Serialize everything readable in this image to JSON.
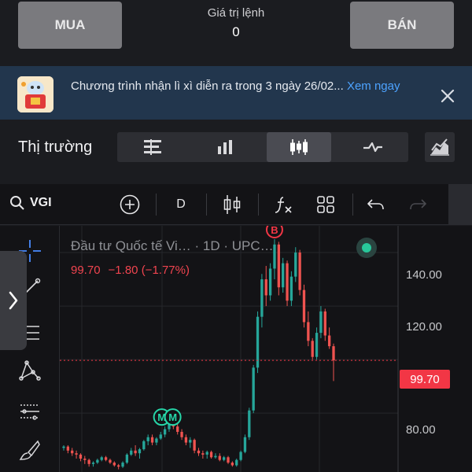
{
  "order": {
    "buy_label": "MUA",
    "sell_label": "BÁN",
    "value_label": "Giá trị lệnh",
    "value": "0"
  },
  "banner": {
    "text": "Chương trình nhận lì xì diễn ra trong 3 ngày 26/02... ",
    "link": "Xem ngay",
    "icon": "lucky-money-mascot-icon",
    "close_icon": "close-icon"
  },
  "market": {
    "title": "Thị trường",
    "views": [
      {
        "name": "order-book-icon",
        "active": false
      },
      {
        "name": "bar-chart-icon",
        "active": false
      },
      {
        "name": "candlestick-icon",
        "active": true
      },
      {
        "name": "line-pulse-icon",
        "active": false
      }
    ],
    "expand_icon": "area-chart-expand-icon"
  },
  "toolbar": {
    "symbol": "VGI",
    "interval": "D",
    "icons": [
      "search-icon",
      "add-symbol-icon",
      "candle-style-icon",
      "indicators-icon",
      "layout-icon",
      "undo-icon",
      "redo-icon"
    ]
  },
  "legend": {
    "name": "Đầu tư Quốc tế Vi…",
    "meta": "· 1D · UPC…",
    "price": "99.70",
    "change": "−1.80",
    "change_pct": "(−1.77%)"
  },
  "axis": {
    "labels": [
      "140.00",
      "120.00",
      "80.00"
    ],
    "last_price": "99.70"
  },
  "markers": [
    {
      "letter": "B",
      "color": "#f23645"
    },
    {
      "letter": "M",
      "color": "#26d6a8"
    },
    {
      "letter": "M",
      "color": "#26d6a8"
    }
  ],
  "colors": {
    "up": "#26a69a",
    "down": "#ef5350",
    "accent": "#f23645",
    "banner_bg": "#22364d",
    "link": "#4da3ff"
  },
  "chart_data": {
    "type": "candlestick",
    "title": "",
    "ylim": [
      58,
      150
    ],
    "y_ticks": [
      80,
      100,
      120,
      140
    ],
    "last_price": 99.7,
    "series": [
      {
        "values": [
          [
            67,
            68,
            66,
            67.5
          ],
          [
            67.5,
            68,
            65,
            66
          ],
          [
            66,
            67,
            64,
            65
          ],
          [
            65,
            66,
            63,
            64.5
          ],
          [
            64.5,
            65,
            62,
            63
          ],
          [
            63,
            64,
            61,
            62.5
          ],
          [
            62.5,
            63,
            60,
            61
          ],
          [
            61,
            62,
            60,
            61.5
          ],
          [
            61.5,
            63,
            61,
            62.5
          ],
          [
            62.5,
            64,
            62,
            63.5
          ],
          [
            63.5,
            64,
            62,
            62.5
          ],
          [
            62.5,
            63,
            61,
            61.5
          ],
          [
            61.5,
            62,
            60,
            60.5
          ],
          [
            60.5,
            61,
            59,
            60
          ],
          [
            60,
            62,
            59.5,
            61.5
          ],
          [
            61.5,
            65,
            61,
            64.5
          ],
          [
            64.5,
            67,
            64,
            66
          ],
          [
            66,
            68,
            64,
            65
          ],
          [
            65,
            67,
            63,
            66.5
          ],
          [
            66.5,
            70,
            66,
            69.5
          ],
          [
            69.5,
            72,
            68,
            71
          ],
          [
            71,
            72,
            68,
            69
          ],
          [
            69,
            71,
            68,
            70.5
          ],
          [
            70.5,
            73,
            70,
            72
          ],
          [
            72,
            75,
            71,
            74
          ],
          [
            74,
            77,
            73,
            76.5
          ],
          [
            76.5,
            78,
            74,
            75
          ],
          [
            75,
            76,
            72,
            73
          ],
          [
            73,
            74,
            70,
            71
          ],
          [
            71,
            72,
            68,
            69
          ],
          [
            69,
            71,
            67,
            70
          ],
          [
            70,
            70.5,
            65,
            66
          ],
          [
            66,
            67,
            64,
            65
          ],
          [
            65,
            66,
            63,
            64.5
          ],
          [
            64.5,
            66,
            63,
            65.5
          ],
          [
            65.5,
            66,
            63,
            63.5
          ],
          [
            63.5,
            65,
            63,
            64
          ],
          [
            64,
            65,
            62,
            62.5
          ],
          [
            62.5,
            64,
            62,
            63.5
          ],
          [
            63.5,
            64,
            61,
            61.5
          ],
          [
            61.5,
            62,
            60,
            60.5
          ],
          [
            60.5,
            63,
            60,
            62.5
          ],
          [
            62.5,
            66,
            62,
            65.5
          ],
          [
            65.5,
            72,
            65,
            71
          ],
          [
            71,
            82,
            70,
            81
          ],
          [
            81,
            98,
            80,
            97
          ],
          [
            97,
            118,
            95,
            116
          ],
          [
            116,
            132,
            112,
            130
          ],
          [
            130,
            135,
            120,
            124
          ],
          [
            124,
            136,
            122,
            134
          ],
          [
            134,
            145,
            130,
            143
          ],
          [
            143,
            144,
            124,
            127
          ],
          [
            127,
            138,
            125,
            136
          ],
          [
            136,
            137,
            120,
            122
          ],
          [
            122,
            133,
            120,
            131
          ],
          [
            131,
            142,
            129,
            140
          ],
          [
            140,
            141,
            124,
            126
          ],
          [
            126,
            128,
            112,
            114
          ],
          [
            114,
            118,
            105,
            107
          ],
          [
            107,
            108,
            100,
            101
          ],
          [
            101,
            112,
            100,
            110
          ],
          [
            110,
            120,
            108,
            118
          ],
          [
            118,
            119,
            107,
            109
          ],
          [
            109,
            112,
            104,
            105
          ],
          [
            105,
            106,
            92,
            99.7
          ]
        ]
      }
    ]
  }
}
